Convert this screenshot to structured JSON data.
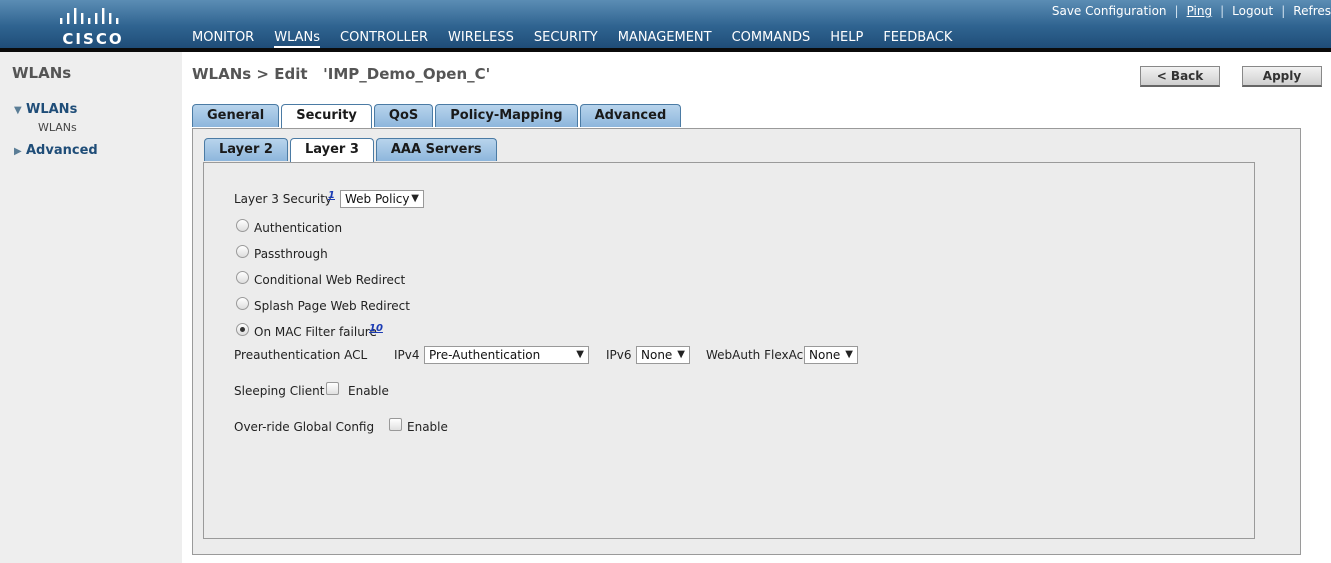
{
  "header": {
    "logo_text": "CISCO",
    "nav": [
      "MONITOR",
      "WLANs",
      "CONTROLLER",
      "WIRELESS",
      "SECURITY",
      "MANAGEMENT",
      "COMMANDS",
      "HELP",
      "FEEDBACK"
    ],
    "active_nav": "WLANs",
    "util": {
      "save": "Save Configuration",
      "ping": "Ping",
      "logout": "Logout",
      "refresh": "Refres",
      "separator": "|"
    }
  },
  "sidebar": {
    "title": "WLANs",
    "items": [
      {
        "label": "WLANs",
        "expanded": true,
        "sub": [
          "WLANs"
        ]
      },
      {
        "label": "Advanced",
        "expanded": false
      }
    ]
  },
  "page": {
    "title": "WLANs > Edit   'IMP_Demo_Open_C'",
    "back_label": "< Back",
    "apply_label": "Apply"
  },
  "tabs": {
    "main": [
      "General",
      "Security",
      "QoS",
      "Policy-Mapping",
      "Advanced"
    ],
    "main_active": "Security",
    "sub": [
      "Layer 2",
      "Layer 3",
      "AAA Servers"
    ],
    "sub_active": "Layer 3"
  },
  "form": {
    "l3_label": "Layer 3 Security",
    "l3_footnote": "1",
    "l3_value": "Web Policy",
    "radios": [
      {
        "label": "Authentication",
        "checked": false
      },
      {
        "label": "Passthrough",
        "checked": false
      },
      {
        "label": "Conditional Web Redirect",
        "checked": false
      },
      {
        "label": "Splash Page Web Redirect",
        "checked": false
      },
      {
        "label": "On MAC Filter failure",
        "checked": true,
        "footnote": "10"
      }
    ],
    "preauth_label": "Preauthentication ACL",
    "ipv4_label": "IPv4",
    "ipv4_value": "Pre-Authentication",
    "ipv6_label": "IPv6",
    "ipv6_value": "None",
    "flexacl_label": "WebAuth FlexAcl",
    "flexacl_value": "None",
    "sleeping_label": "Sleeping Client",
    "sleeping_enable": "Enable",
    "override_label": "Over-ride Global Config",
    "override_enable": "Enable"
  },
  "icons": {
    "logo": "cisco-bars-icon",
    "expanded": "triangle-down-icon",
    "collapsed": "triangle-right-icon",
    "dropdown": "caret-down-icon"
  }
}
